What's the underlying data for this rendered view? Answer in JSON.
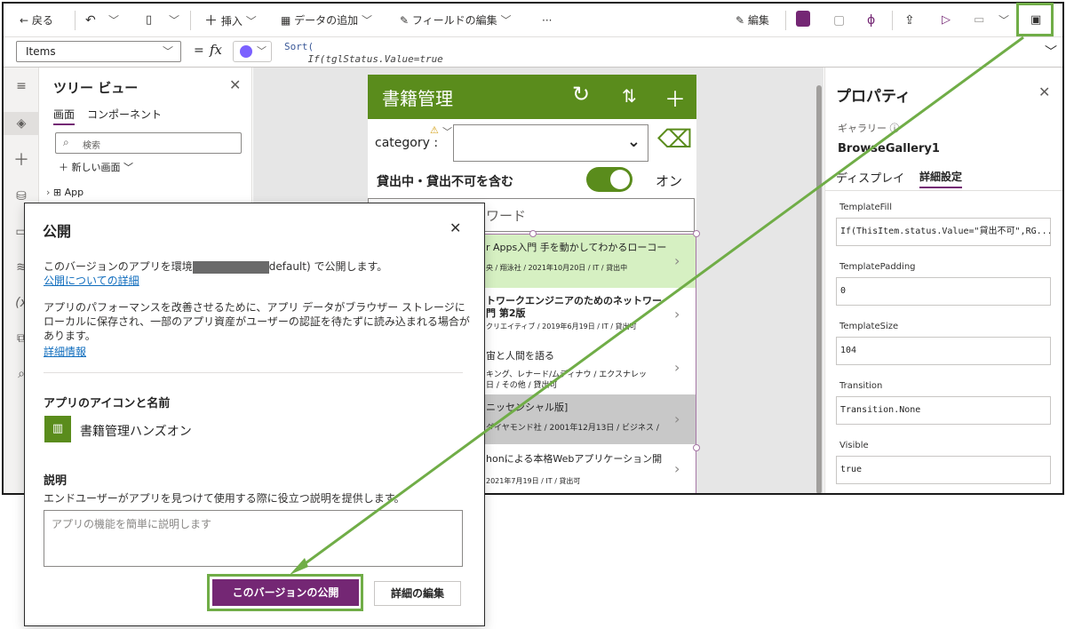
{
  "toolbar": {
    "back": "戻る",
    "insert": "挿入",
    "add_data": "データの追加",
    "edit_fields": "フィールドの編集",
    "more": "···",
    "edit": "編集"
  },
  "formula_bar": {
    "property": "Items",
    "equals": "=",
    "fx": "fx",
    "formula_line1": "Sort(",
    "formula_line2": "    If(tglStatus.Value=true"
  },
  "tree": {
    "title": "ツリー ビュー",
    "tab_screens": "画面",
    "tab_components": "コンポーネント",
    "search_placeholder": "検索",
    "new_screen": "新しい画面",
    "app_item": "App"
  },
  "preview": {
    "app_title": "書籍管理",
    "category_label": "category :",
    "toggle_label": "貸出中・貸出不可を含む",
    "toggle_state": "オン",
    "search_text": "ワード",
    "items": [
      {
        "title": "r Apps入門 手を動かしてわかるローコー",
        "subtitle": "央 / 翔泳社 / 2021年10月20日 / IT / 貸出中"
      },
      {
        "title": "トワークエンジニアのためのネットワー",
        "title2": "門 第2版",
        "subtitle": "クリエイティブ / 2019年6月19日 / IT / 貸出可"
      },
      {
        "title": "宙と人間を語る",
        "subtitle": "キング、レナード/ムディナウ / エクスナレッ",
        "subtitle2": "日 / その他 / 貸出可"
      },
      {
        "title": "ニッセンシャル版]",
        "subtitle": "ダイヤモンド社 / 2001年12月13日 / ビジネス /"
      },
      {
        "title": "honによる本格Webアプリケーション開",
        "subtitle": "2021年7月19日 / IT / 貸出可"
      }
    ]
  },
  "properties": {
    "title": "プロパティ",
    "type_label": "ギャラリー",
    "control_name": "BrowseGallery1",
    "tab_display": "ディスプレイ",
    "tab_advanced": "詳細設定",
    "fields": [
      {
        "label": "TemplateFill",
        "value": "If(ThisItem.status.Value=\"貸出不可\",RG..."
      },
      {
        "label": "TemplatePadding",
        "value": "0"
      },
      {
        "label": "TemplateSize",
        "value": "104"
      },
      {
        "label": "Transition",
        "value": "Transition.None"
      },
      {
        "label": "Visible",
        "value": "true"
      }
    ]
  },
  "dialog": {
    "title": "公開",
    "env_text_before": "このバージョンのアプリを環境",
    "env_text_after": "default) で公開します。",
    "details_link": "公開についての詳細",
    "perf_text": "アプリのパフォーマンスを改善させるために、アプリ データがブラウザー ストレージにローカルに保存され、一部のアプリ資産がユーザーの認証を待たずに読み込まれる場合があります。",
    "more_info_link": "詳細情報",
    "icon_section": "アプリのアイコンと名前",
    "app_name": "書籍管理ハンズオン",
    "desc_section": "説明",
    "desc_help": "エンドユーザーがアプリを見つけて使用する際に役立つ説明を提供します。",
    "desc_placeholder": "アプリの機能を簡単に説明します",
    "publish_button": "このバージョンの公開",
    "edit_details_button": "詳細の編集"
  },
  "colors": {
    "accent_purple": "#742774",
    "header_green": "#5a8c1c",
    "annotation_green": "#70ad47",
    "selected_row": "#d6f0c2",
    "disabled_row": "#c8c8c8"
  }
}
